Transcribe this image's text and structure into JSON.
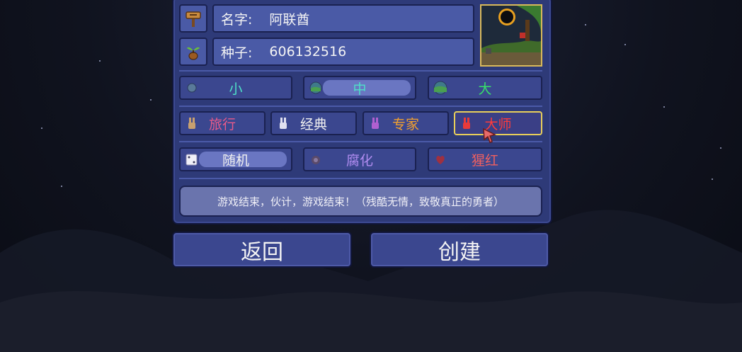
{
  "world": {
    "name_label": "名字:",
    "name_value": "阿联酋",
    "seed_label": "种子:",
    "seed_value": "606132516"
  },
  "icons": {
    "name": "signpost-icon",
    "seed": "acorn-sapling-icon"
  },
  "size_options": [
    {
      "label": "小",
      "selected": false,
      "color": "#4fe0c8"
    },
    {
      "label": "中",
      "selected": true,
      "color": "#4fe0c8"
    },
    {
      "label": "大",
      "selected": false,
      "color": "#37e06a"
    }
  ],
  "difficulty_options": [
    {
      "label": "旅行",
      "selected": false,
      "color": "#e85a8a"
    },
    {
      "label": "经典",
      "selected": false,
      "color": "#f0f0f0"
    },
    {
      "label": "专家",
      "selected": false,
      "color": "#f0a030"
    },
    {
      "label": "大师",
      "selected": true,
      "color": "#ff3b3b"
    }
  ],
  "evil_options": [
    {
      "label": "随机",
      "selected": true,
      "color": "#f0f0f0"
    },
    {
      "label": "腐化",
      "selected": false,
      "color": "#b08cf0"
    },
    {
      "label": "猩红",
      "selected": false,
      "color": "#f06060"
    }
  ],
  "description": "游戏结束，伙计，游戏结束！（残酷无情，致敬真正的勇者）",
  "buttons": {
    "back": "返回",
    "create": "创建"
  }
}
